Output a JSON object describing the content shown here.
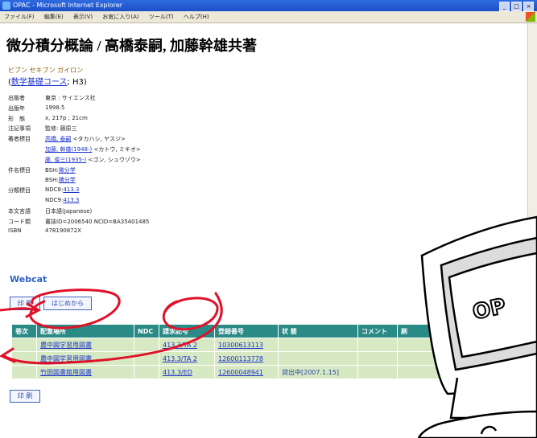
{
  "window": {
    "title": "OPAC - Microsoft Internet Explorer",
    "controls": [
      "_",
      "□",
      "×"
    ]
  },
  "menu": [
    "ファイル(F)",
    "編集(E)",
    "表示(V)",
    "お気に入り(A)",
    "ツール(T)",
    "ヘルプ(H)"
  ],
  "record": {
    "title": "微分積分概論 / 高橋泰嗣, 加藤幹雄共著",
    "kana": "ビブン セキブン ガイロン",
    "series_prefix": "(",
    "series_link": "数学基礎コース",
    "series_suffix": "; H3)",
    "meta": [
      {
        "label": "出版者",
        "value": "東京 : サイエンス社"
      },
      {
        "label": "出版年",
        "value": "1998.5"
      },
      {
        "label": "形　態",
        "value": "x, 217p ; 21cm"
      },
      {
        "label": "注記事項",
        "value": "監修: 藤原三"
      },
      {
        "label": "著者標目",
        "link": "高橋, 泰嗣",
        "value": "<タカハシ, ヤスジ>"
      },
      {
        "label": "",
        "link": "加藤, 幹雄(1948-)",
        "value": "<カトウ, ミキオ>"
      },
      {
        "label": "",
        "link": "藤, 俊三(1935-)",
        "value": "<ゴン, シュウゾウ>"
      },
      {
        "label": "件名標目",
        "prefix": "BSH:",
        "link": "微分学"
      },
      {
        "label": "",
        "prefix": "BSH:",
        "link": "積分学"
      },
      {
        "label": "分類標目",
        "prefix": "NDC8:",
        "link": "413.3"
      },
      {
        "label": "",
        "prefix": "NDC9:",
        "link": "413.3"
      },
      {
        "label": "本文言語",
        "value": "日本語(Japanese)"
      },
      {
        "label": "コード類",
        "value": "書誌ID=2006540 NCID=BA35401485"
      },
      {
        "label": "ISBN",
        "value": "478190872X"
      }
    ],
    "webcat": "Webcat"
  },
  "buttons": {
    "print": "印 刷",
    "restart": "はじめから",
    "bottom": "印 刷"
  },
  "holdings": {
    "headers": [
      "巻次",
      "配置場所",
      "NDC",
      "請求記号",
      "登録番号",
      "状 態",
      "コメント",
      "刷"
    ],
    "rows": [
      [
        "",
        "農中図学習用図書",
        "",
        "413.3/TA 2",
        "10300613113",
        "",
        "",
        ""
      ],
      [
        "",
        "農中図学習用図書",
        "",
        "413.3/TA 2",
        "12600113778",
        "",
        "",
        ""
      ],
      [
        "",
        "竹田図書館用図書",
        "",
        "413.3/ED",
        "12600048941",
        "貸出中[2007.1.15]",
        "",
        ""
      ]
    ]
  },
  "sticker": {
    "text": "OP"
  }
}
